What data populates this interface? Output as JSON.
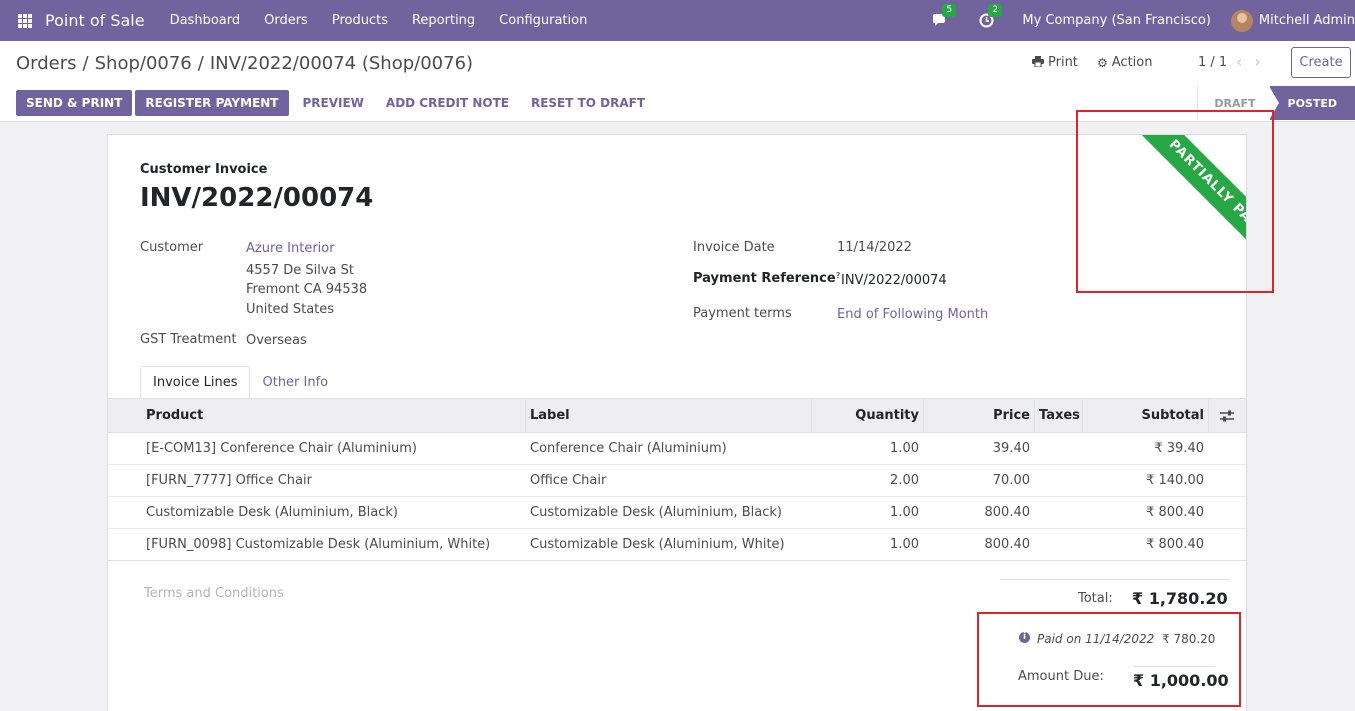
{
  "navbar": {
    "app_name": "Point of Sale",
    "menu": [
      "Dashboard",
      "Orders",
      "Products",
      "Reporting",
      "Configuration"
    ],
    "messages_count": "5",
    "activities_count": "2",
    "company": "My Company (San Francisco)",
    "user": "Mitchell Admin",
    "colors": {
      "brand": "#71639e",
      "badge": "#28a745"
    }
  },
  "breadcrumb": [
    "Orders",
    "Shop/0076",
    "INV/2022/00074 (Shop/0076)"
  ],
  "control": {
    "print_label": "Print",
    "action_label": "Action",
    "pager": "1 / 1",
    "create_label": "Create",
    "buttons": {
      "send_print": "SEND & PRINT",
      "register_payment": "REGISTER PAYMENT",
      "preview": "PREVIEW",
      "add_credit_note": "ADD CREDIT NOTE",
      "reset_to_draft": "RESET TO DRAFT"
    },
    "stages": {
      "draft": "DRAFT",
      "posted": "POSTED",
      "current": "POSTED"
    }
  },
  "invoice": {
    "type": "Customer Invoice",
    "name": "INV/2022/00074",
    "ribbon": "PARTIALLY PAID",
    "customer_label": "Customer",
    "customer_name": "Azure Interior",
    "address_line1": "4557 De Silva St",
    "address_line2": "Fremont CA 94538",
    "address_line3": "United States",
    "gst_label": "GST Treatment",
    "gst_value": "Overseas",
    "invoice_date_label": "Invoice Date",
    "invoice_date": "11/14/2022",
    "payment_ref_label": "Payment Reference",
    "payment_ref_help": "?",
    "payment_ref": "INV/2022/00074",
    "payment_terms_label": "Payment terms",
    "payment_terms": "End of Following Month"
  },
  "tabs": [
    "Invoice Lines",
    "Other Info"
  ],
  "table": {
    "headers": {
      "product": "Product",
      "label": "Label",
      "quantity": "Quantity",
      "price": "Price",
      "taxes": "Taxes",
      "subtotal": "Subtotal"
    },
    "rows": [
      {
        "product": "[E-COM13] Conference Chair (Aluminium)",
        "label": "Conference Chair (Aluminium)",
        "quantity": "1.00",
        "price": "39.40",
        "taxes": "",
        "subtotal": "₹ 39.40"
      },
      {
        "product": "[FURN_7777] Office Chair",
        "label": "Office Chair",
        "quantity": "2.00",
        "price": "70.00",
        "taxes": "",
        "subtotal": "₹ 140.00"
      },
      {
        "product": "Customizable Desk (Aluminium, Black)",
        "label": "Customizable Desk (Aluminium, Black)",
        "quantity": "1.00",
        "price": "800.40",
        "taxes": "",
        "subtotal": "₹ 800.40"
      },
      {
        "product": "[FURN_0098] Customizable Desk (Aluminium, White)",
        "label": "Customizable Desk (Aluminium, White)",
        "quantity": "1.00",
        "price": "800.40",
        "taxes": "",
        "subtotal": "₹ 800.40"
      }
    ]
  },
  "footer": {
    "terms_placeholder": "Terms and Conditions",
    "total_label": "Total:",
    "total_value": "₹ 1,780.20",
    "paid_text": "Paid on 11/14/2022",
    "paid_amount": "₹ 780.20",
    "amount_due_label": "Amount Due:",
    "amount_due_value": "₹ 1,000.00"
  }
}
